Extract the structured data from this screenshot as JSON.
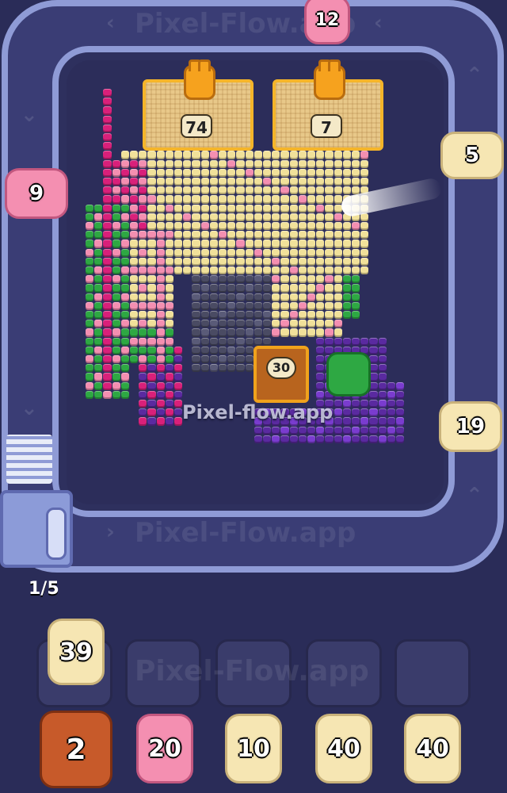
{
  "watermarks": {
    "top": "Pixel-Flow.app",
    "middle": "Pixel-flow.app",
    "bottom": "Pixel-Flow.app",
    "right": "Pixel-Flow.app",
    "left": "Pixel-Flow.app",
    "slots": "Pixel-Flow.app"
  },
  "trays": [
    {
      "count": "74"
    },
    {
      "count": "7"
    }
  ],
  "chest": {
    "count": "30"
  },
  "track_pigs": [
    {
      "name": "pig-top",
      "count": "12",
      "color": "pink"
    },
    {
      "name": "pig-left",
      "count": "9",
      "color": "pink"
    },
    {
      "name": "pig-right-upper",
      "count": "5",
      "color": "cream"
    },
    {
      "name": "pig-right-lower",
      "count": "19",
      "color": "cream"
    }
  ],
  "level": {
    "progress": "1/5",
    "current": 1,
    "total": 5
  },
  "slots": {
    "first_pig": "39",
    "empty_slot_count": 4
  },
  "queue": [
    {
      "count": "2",
      "color": "brown"
    },
    {
      "count": "20",
      "color": "pink"
    },
    {
      "count": "10",
      "color": "cream"
    },
    {
      "count": "40",
      "color": "cream"
    },
    {
      "count": "40",
      "color": "cream"
    }
  ],
  "colors": {
    "background": "#2a2c58",
    "track": "#3a3d75",
    "track_rim": "#8f9bd6",
    "pink": "#f48fb1",
    "cream": "#f6e6b3",
    "green": "#2ea843",
    "purple": "#5a2aa0",
    "dark_gray": "#4a4b63",
    "magenta": "#d9207a"
  }
}
